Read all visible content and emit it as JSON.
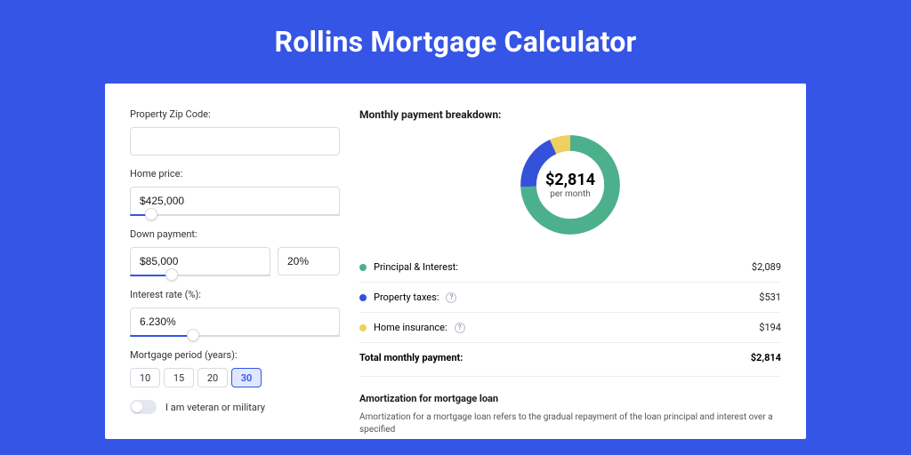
{
  "header": {
    "title": "Rollins Mortgage Calculator"
  },
  "form": {
    "zip_label": "Property Zip Code:",
    "zip_value": "",
    "home_price_label": "Home price:",
    "home_price_value": "$425,000",
    "down_payment_label": "Down payment:",
    "down_payment_amount": "$85,000",
    "down_payment_percent": "20%",
    "interest_rate_label": "Interest rate (%):",
    "interest_rate_value": "6.230%",
    "mortgage_period_label": "Mortgage period (years):",
    "period_options": [
      "10",
      "15",
      "20",
      "30"
    ],
    "period_selected": "30",
    "veteran_label": "I am veteran or military"
  },
  "breakdown": {
    "title": "Monthly payment breakdown:",
    "donut_amount": "$2,814",
    "donut_sub": "per month",
    "rows": [
      {
        "label": "Principal & Interest:",
        "value": "$2,089",
        "color": "green",
        "info": false
      },
      {
        "label": "Property taxes:",
        "value": "$531",
        "color": "blue",
        "info": true
      },
      {
        "label": "Home insurance:",
        "value": "$194",
        "color": "yellow",
        "info": true
      }
    ],
    "total_label": "Total monthly payment:",
    "total_value": "$2,814"
  },
  "amortization": {
    "title": "Amortization for mortgage loan",
    "text": "Amortization for a mortgage loan refers to the gradual repayment of the loan principal and interest over a specified"
  },
  "chart_data": {
    "type": "pie",
    "title": "Monthly payment breakdown",
    "total": 2814,
    "unit": "USD per month",
    "series": [
      {
        "name": "Principal & Interest",
        "value": 2089,
        "color": "#4cb08c"
      },
      {
        "name": "Property taxes",
        "value": 531,
        "color": "#3452d9"
      },
      {
        "name": "Home insurance",
        "value": 194,
        "color": "#efcf5e"
      }
    ]
  }
}
